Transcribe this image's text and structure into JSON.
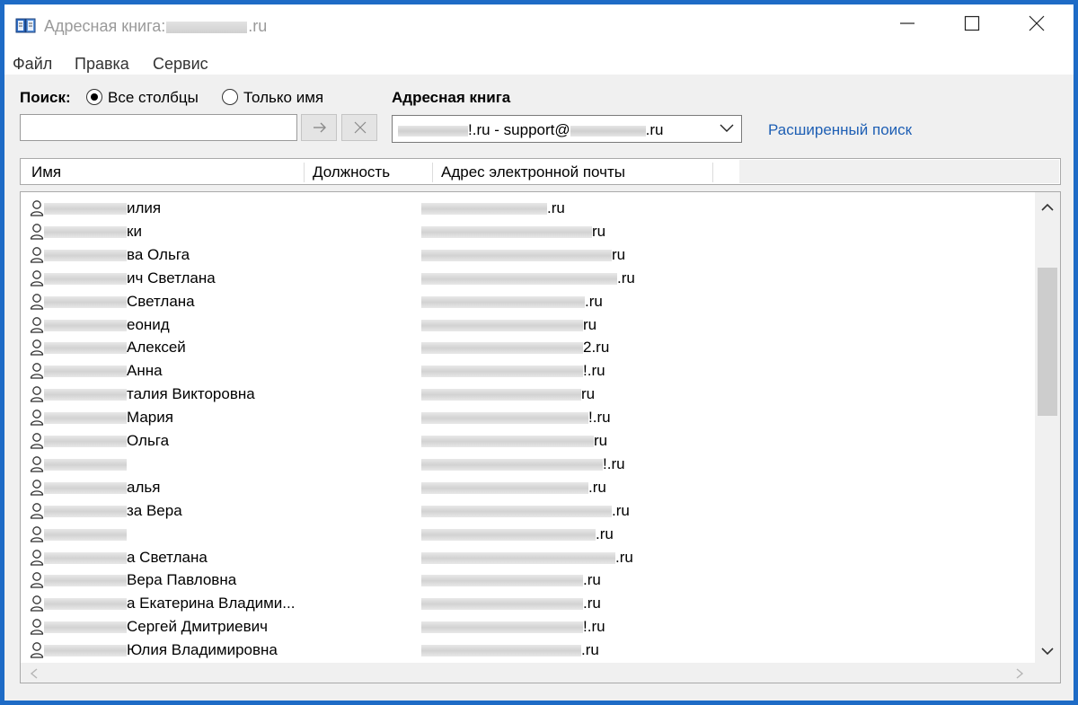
{
  "window": {
    "title_prefix": "Адресная книга:",
    "title_suffix": ".ru"
  },
  "menu": [
    "Файл",
    "Правка",
    "Сервис"
  ],
  "search": {
    "label": "Поиск:",
    "option_all": "Все столбцы",
    "option_name": "Только имя",
    "selected": "option_all",
    "value": ""
  },
  "address_book": {
    "label": "Адресная книга",
    "selected_prefix": "!.ru - support@",
    "selected_suffix": ".ru"
  },
  "advanced_search": "Расширенный поиск",
  "columns": [
    "Имя",
    "Должность",
    "Адрес электронной почты"
  ],
  "rows": [
    {
      "name": "илия",
      "mail": ".ru",
      "mail_blur": 140
    },
    {
      "name": "ки",
      "mail": "ru",
      "mail_blur": 190
    },
    {
      "name": "ва Ольга",
      "mail": "ru",
      "mail_blur": 212
    },
    {
      "name": "ич Светлана",
      "mail": ".ru",
      "mail_blur": 218
    },
    {
      "name": "Светлана",
      "mail": ".ru",
      "mail_blur": 182
    },
    {
      "name": "еонид",
      "mail": "ru",
      "mail_blur": 180
    },
    {
      "name": "Алексей",
      "mail": "2.ru",
      "mail_blur": 180
    },
    {
      "name": "Анна",
      "mail": "!.ru",
      "mail_blur": 180
    },
    {
      "name": "талия Викторовна",
      "mail": "ru",
      "mail_blur": 178
    },
    {
      "name": "Мария",
      "mail": "!.ru",
      "mail_blur": 186
    },
    {
      "name": "Ольга",
      "mail": "ru",
      "mail_blur": 192
    },
    {
      "name": "",
      "mail": "!.ru",
      "mail_blur": 202
    },
    {
      "name": "алья",
      "mail": ".ru",
      "mail_blur": 186
    },
    {
      "name": "за Вера",
      "mail": ".ru",
      "mail_blur": 212
    },
    {
      "name": "",
      "mail": ".ru",
      "mail_blur": 194
    },
    {
      "name": "а Светлана",
      "mail": ".ru",
      "mail_blur": 216
    },
    {
      "name": "Вера Павловна",
      "mail": ".ru",
      "mail_blur": 180
    },
    {
      "name": "а Екатерина Владими...",
      "mail": ".ru",
      "mail_blur": 180
    },
    {
      "name": "Сергей Дмитриевич",
      "mail": "!.ru",
      "mail_blur": 180
    },
    {
      "name": "Юлия Владимировна",
      "mail": ".ru",
      "mail_blur": 178
    }
  ],
  "scroll": {
    "vertical_position": 0.15
  }
}
